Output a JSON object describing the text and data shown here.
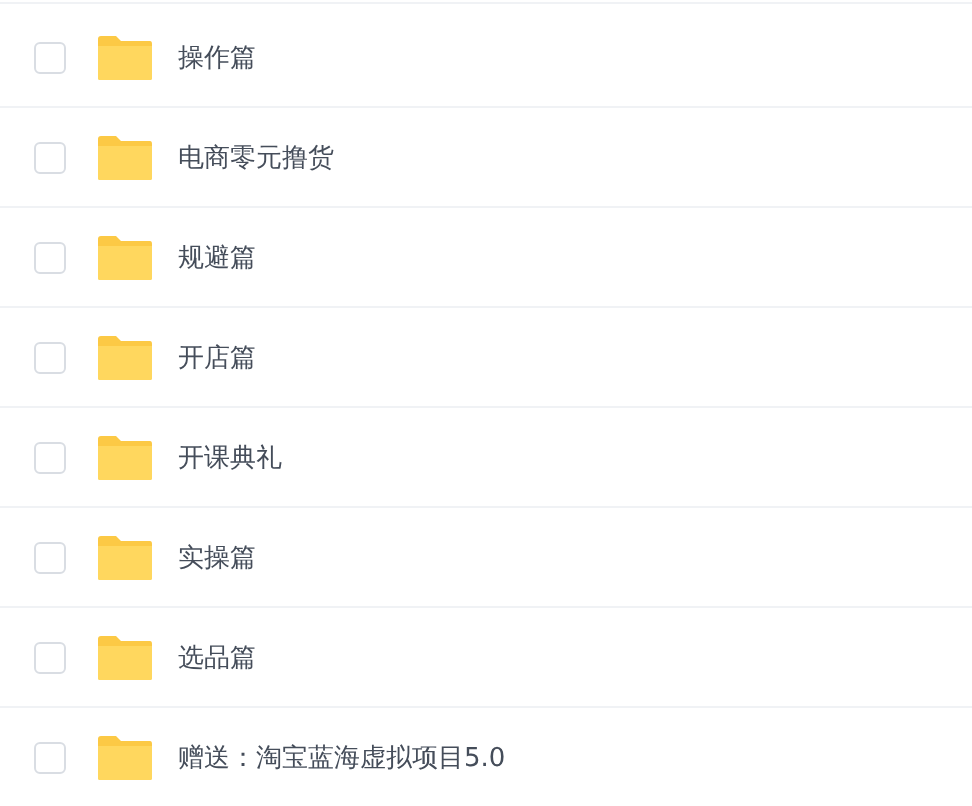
{
  "files": [
    {
      "name": "操作篇",
      "checked": false
    },
    {
      "name": "电商零元撸货",
      "checked": false
    },
    {
      "name": "规避篇",
      "checked": false
    },
    {
      "name": "开店篇",
      "checked": false
    },
    {
      "name": "开课典礼",
      "checked": false
    },
    {
      "name": "实操篇",
      "checked": false
    },
    {
      "name": "选品篇",
      "checked": false
    },
    {
      "name": "赠送：淘宝蓝海虚拟项目5.0",
      "checked": false
    }
  ]
}
